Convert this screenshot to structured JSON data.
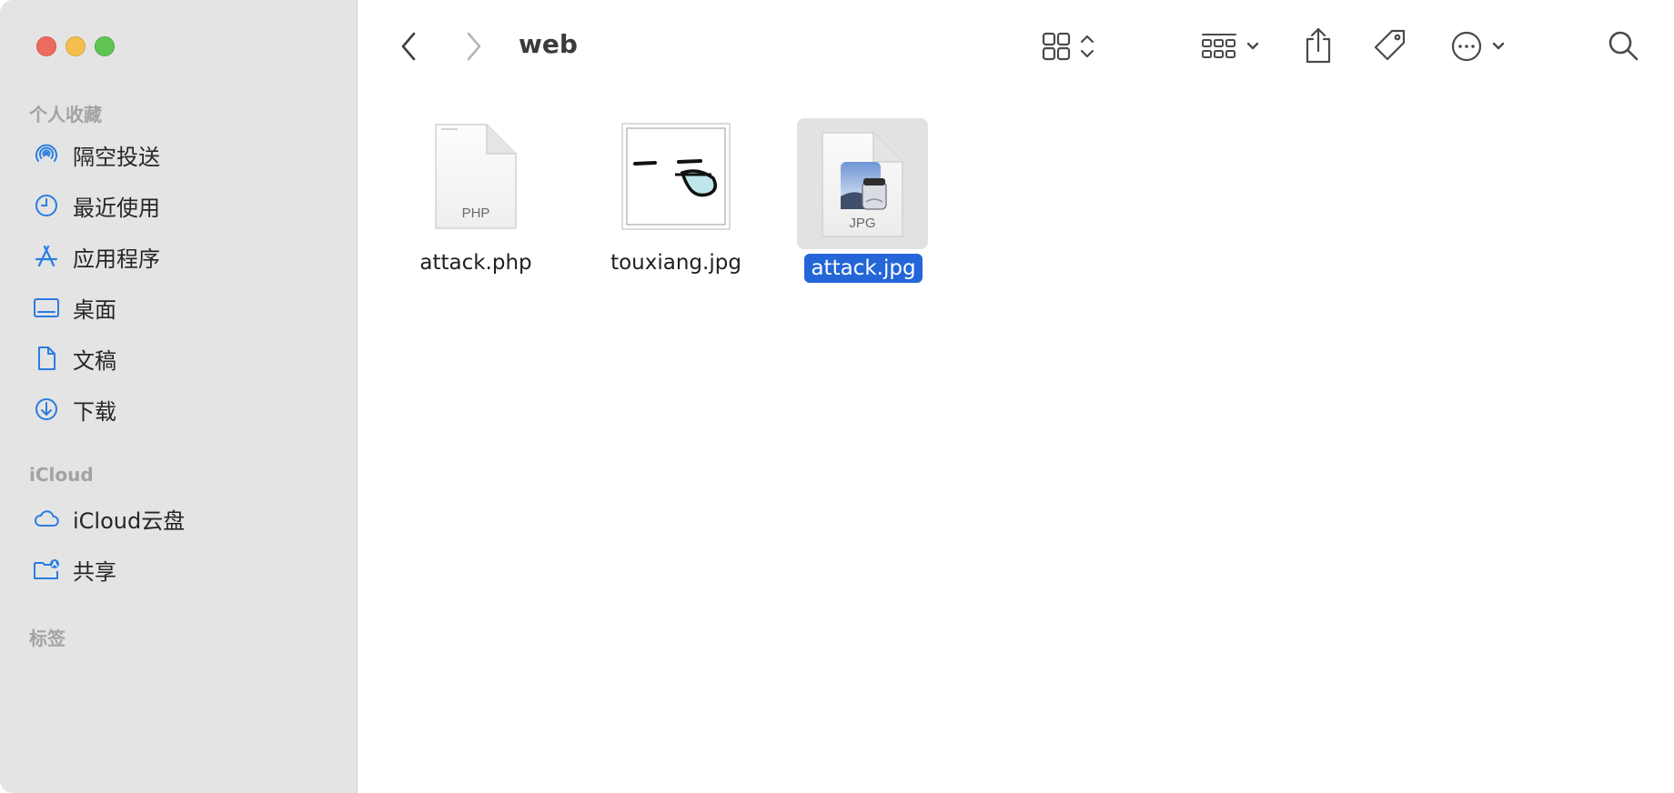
{
  "window": {
    "title": "web"
  },
  "sidebar": {
    "favorites_title": "个人收藏",
    "favorites": [
      {
        "label": "隔空投送",
        "icon": "airdrop-icon"
      },
      {
        "label": "最近使用",
        "icon": "clock-icon"
      },
      {
        "label": "应用程序",
        "icon": "applications-icon"
      },
      {
        "label": "桌面",
        "icon": "desktop-icon"
      },
      {
        "label": "文稿",
        "icon": "document-icon"
      },
      {
        "label": "下载",
        "icon": "download-icon"
      }
    ],
    "icloud_title": "iCloud",
    "icloud": [
      {
        "label": "iCloud云盘",
        "icon": "cloud-icon"
      },
      {
        "label": "共享",
        "icon": "shared-folder-icon"
      }
    ],
    "tags_title": "标签"
  },
  "toolbar": {
    "back": "back-chevron-icon",
    "forward": "forward-chevron-icon",
    "view": "grid-view-icon",
    "group": "group-icon",
    "share": "share-icon",
    "tag": "tag-icon",
    "more": "more-icon",
    "search": "search-icon"
  },
  "files": [
    {
      "name": "attack.php",
      "type_label": "PHP",
      "selected": false
    },
    {
      "name": "touxiang.jpg",
      "type_label": "",
      "selected": false
    },
    {
      "name": "attack.jpg",
      "type_label": "JPG",
      "selected": true
    }
  ],
  "colors": {
    "accent": "#2466d8",
    "sidebar_bg": "#e4e4e4",
    "sidebar_icon": "#2a7de1"
  }
}
